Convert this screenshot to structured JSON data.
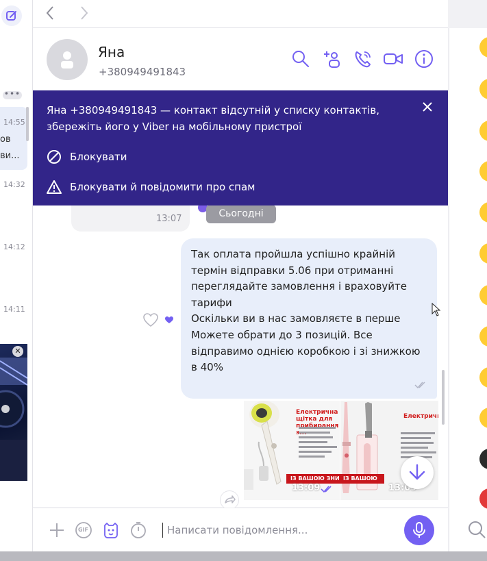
{
  "left_panel": {
    "list_dots": "•••",
    "times": [
      "14:55",
      "14:32",
      "14:12",
      "14:11"
    ],
    "trunc_1": "ов",
    "trunc_2": "ви..."
  },
  "header": {
    "name": "Яна",
    "phone": "+380949491843"
  },
  "banner": {
    "text": "Яна +380949491843 — контакт відсутній у списку контактів, збережіть його у Viber на мобільному пристрої",
    "block": "Блокувати",
    "block_report": "Блокувати й повідомити про спам"
  },
  "chat": {
    "prev_time": "13:07",
    "date_divider": "Сьогодні",
    "message": "Так оплата пройшла успішно крайній термін відправки 5.06 при отриманні переглядайте замовлення і враховуйте тарифи\nОскільки ви в нас замовляєте в перше Можете обрати до 3 позицій. Все відправимо однією коробкою і зі знижкою в 40%",
    "photo1_title": "Електрична щітка для прибирання з...",
    "photo1_time": "13:09",
    "photo2_title": "Електрична...",
    "photo2_time": "13:09",
    "photo1_promo": "ІЗ ВАШОЮ ЗНИ",
    "photo2_promo": "ІЗ ВАШОЮ ЗНИ"
  },
  "composer": {
    "placeholder": "Написати повідомлення...",
    "gif_label": "GIF"
  },
  "colors": {
    "accent": "#7360f2",
    "banner": "#322589",
    "bubble": "#e8eefa"
  }
}
